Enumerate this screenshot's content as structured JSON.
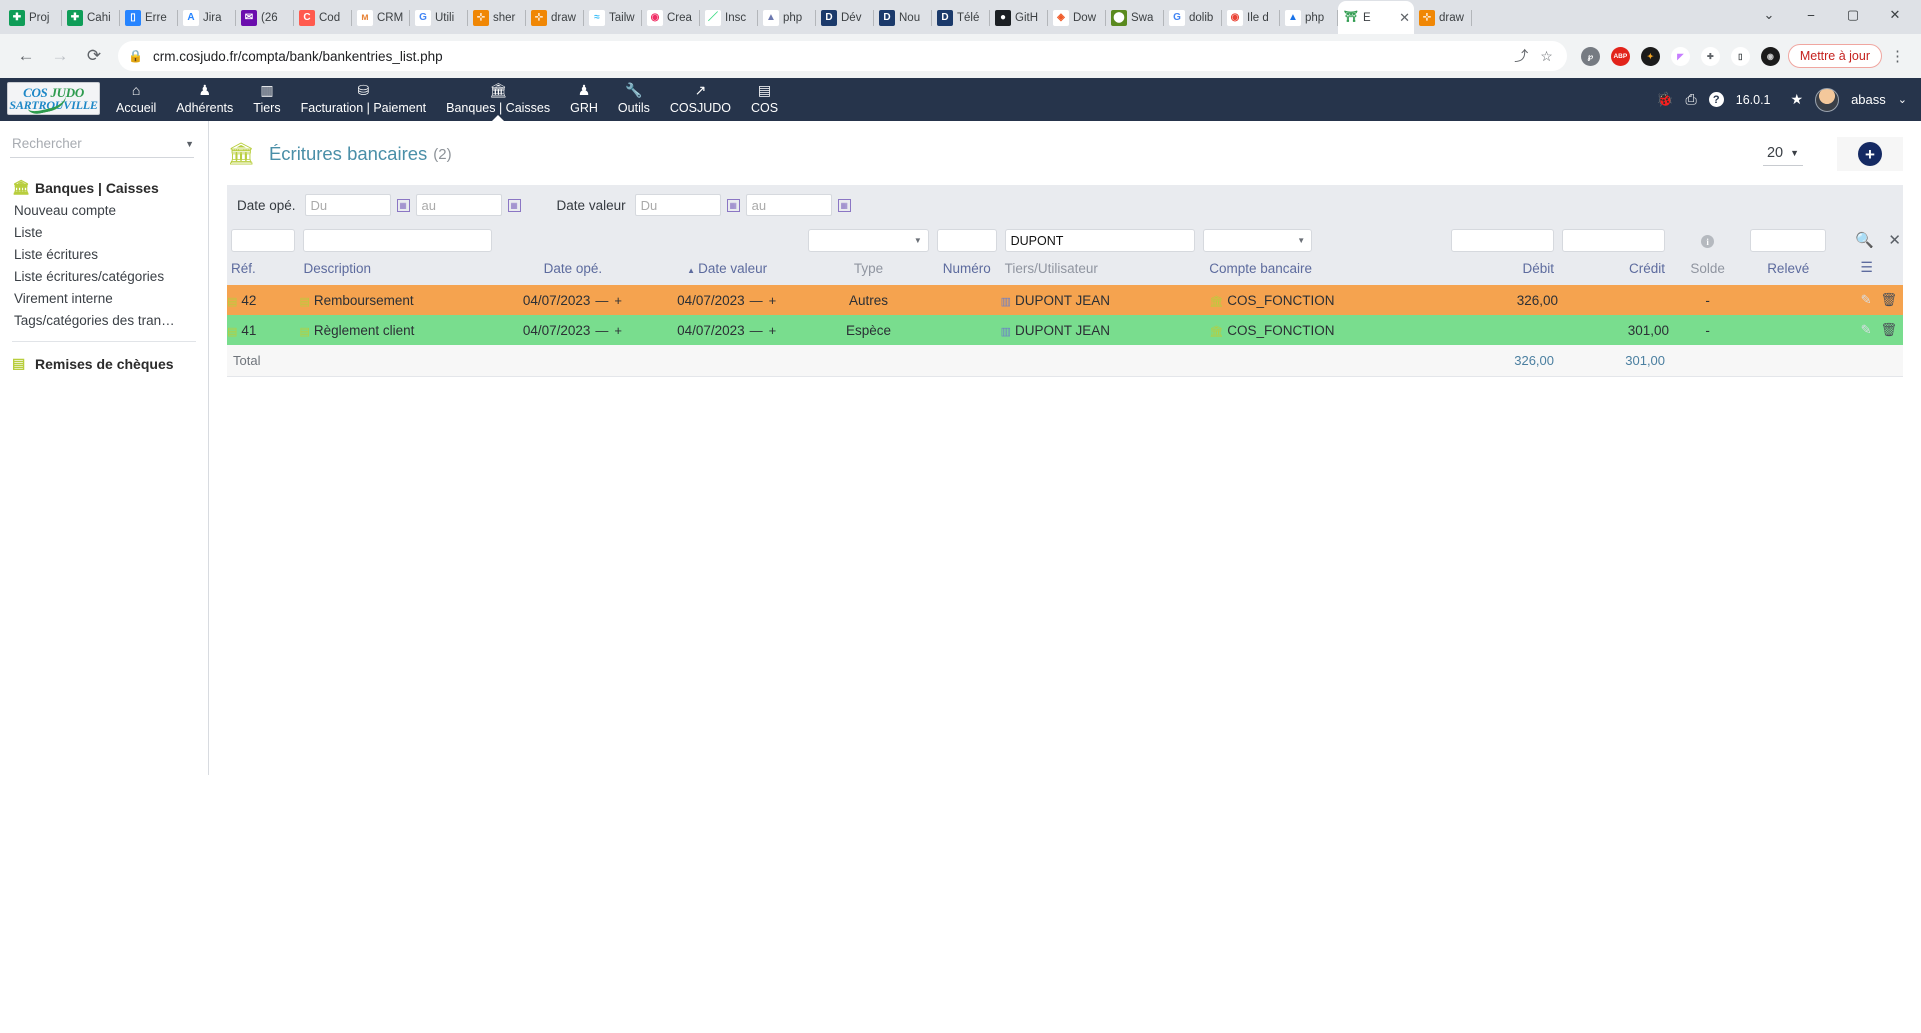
{
  "browser": {
    "tabs": [
      {
        "label": "Proj",
        "fav": "drive-green",
        "glyph": "✚",
        "bg": "#0f9d58"
      },
      {
        "label": "Cahi",
        "fav": "drive-green",
        "glyph": "✚",
        "bg": "#0f9d58"
      },
      {
        "label": "Erre",
        "fav": "trello",
        "glyph": "▯",
        "bg": "#2684ff"
      },
      {
        "label": "Jira",
        "fav": "jira",
        "glyph": "A",
        "bg": "#ffffff",
        "fg": "#2684ff"
      },
      {
        "label": "(26",
        "fav": "mail",
        "glyph": "✉",
        "bg": "#6a0dad"
      },
      {
        "label": "Cod",
        "fav": "clickup",
        "glyph": "C",
        "bg": "#ff5a4e"
      },
      {
        "label": "CRM",
        "fav": "crm",
        "glyph": "м",
        "bg": "#ffffff",
        "fg": "#e8853a"
      },
      {
        "label": "Utili",
        "fav": "google",
        "glyph": "G",
        "bg": "#ffffff",
        "fg": "#4285f4"
      },
      {
        "label": "sher",
        "fav": "drawio",
        "glyph": "⊹",
        "bg": "#f08705"
      },
      {
        "label": "draw",
        "fav": "drawio",
        "glyph": "⊹",
        "bg": "#f08705"
      },
      {
        "label": "Tailw",
        "fav": "tailwind",
        "glyph": "≈",
        "bg": "#ffffff",
        "fg": "#38bdf8"
      },
      {
        "label": "Crea",
        "fav": "appwrite",
        "glyph": "◉",
        "bg": "#ffffff",
        "fg": "#f02e65"
      },
      {
        "label": "Insc",
        "fav": "slash",
        "glyph": "／",
        "bg": "#ffffff",
        "fg": "#3ddc84"
      },
      {
        "label": "php",
        "fav": "phpmyadmin",
        "glyph": "▲",
        "bg": "#ffffff",
        "fg": "#6c78af"
      },
      {
        "label": "Dév",
        "fav": "dolibarr",
        "glyph": "D",
        "bg": "#1b3a6b"
      },
      {
        "label": "Nou",
        "fav": "dolibarr",
        "glyph": "D",
        "bg": "#1b3a6b"
      },
      {
        "label": "Télé",
        "fav": "dolibarr",
        "glyph": "D",
        "bg": "#1b3a6b"
      },
      {
        "label": "GitH",
        "fav": "github",
        "glyph": "●",
        "bg": "#1b1f23"
      },
      {
        "label": "Dow",
        "fav": "diamond",
        "glyph": "◈",
        "bg": "#ffffff",
        "fg": "#f05a28"
      },
      {
        "label": "Swa",
        "fav": "swagger",
        "glyph": "⬤",
        "bg": "#5a8a1f"
      },
      {
        "label": "dolib",
        "fav": "google",
        "glyph": "G",
        "bg": "#ffffff",
        "fg": "#4285f4"
      },
      {
        "label": "Ile d",
        "fav": "maps-pin",
        "glyph": "◉",
        "bg": "#ffffff",
        "fg": "#ea4335"
      },
      {
        "label": "php",
        "fav": "google-drive",
        "glyph": "▲",
        "bg": "#ffffff",
        "fg": "#1a73e8"
      },
      {
        "label": "draw",
        "fav": "drawio",
        "glyph": "⊹",
        "bg": "#f08705"
      }
    ],
    "active_tab": {
      "label": "É",
      "fav": "cosjudo",
      "glyph": "⛩",
      "bg": "#ffffff",
      "fg": "#2e9b4e",
      "close": "✕"
    },
    "window_controls": {
      "minimize": "⎯",
      "maximize": "▢",
      "close": "✕",
      "more": "⌄"
    },
    "nav": {
      "back": "←",
      "forward": "→",
      "reload": "⟳"
    },
    "omnibox": {
      "lock_icon": "lock-icon",
      "url": "crm.cosjudo.fr/compta/bank/bankentries_list.php",
      "share_icon": "share-icon",
      "bookmark_icon": "star-icon"
    },
    "extensions": [
      {
        "name": "pinterest-extension",
        "glyph": "℘",
        "bg": "#767b82",
        "fg": "#ffffff"
      },
      {
        "name": "adblock-plus-extension",
        "glyph": "ABP",
        "bg": "#e2231a",
        "fg": "#ffffff"
      },
      {
        "name": "honey-extension",
        "glyph": "✦",
        "bg": "#1b1b1b",
        "fg": "#f5a623"
      },
      {
        "name": "colorzilla-extension",
        "glyph": "◤",
        "bg": "#ffffff",
        "fg": "#c77dff"
      },
      {
        "name": "puzzle-extensions-icon",
        "glyph": "✚",
        "bg": "#ffffff",
        "fg": "#5f6368"
      },
      {
        "name": "sidepanel-icon",
        "glyph": "▯",
        "bg": "#ffffff",
        "fg": "#3c4043"
      },
      {
        "name": "profile-icon",
        "glyph": "◉",
        "bg": "#1b1b1b",
        "fg": "#cccccc"
      }
    ],
    "update_label": "Mettre à jour",
    "menu_icon": "kebab-menu-icon"
  },
  "appnav": {
    "logo": {
      "line1_a": "COS",
      "line1_b": "JUDO",
      "line2": "SARTROUVILLE"
    },
    "items": [
      {
        "label": "Accueil",
        "icon": "home-icon",
        "glyph": "⌂",
        "active": false
      },
      {
        "label": "Adhérents",
        "icon": "user-icon",
        "glyph": "♟",
        "active": false
      },
      {
        "label": "Tiers",
        "icon": "building-icon",
        "glyph": "▥",
        "active": false
      },
      {
        "label": "Facturation | Paiement",
        "icon": "invoice-icon",
        "glyph": "⛁",
        "active": false
      },
      {
        "label": "Banques | Caisses",
        "icon": "bank-icon",
        "glyph": "🏛",
        "active": true
      },
      {
        "label": "GRH",
        "icon": "hr-user-icon",
        "glyph": "♟",
        "active": false
      },
      {
        "label": "Outils",
        "icon": "wrench-icon",
        "glyph": "🔧",
        "active": false
      },
      {
        "label": "COSJUDO",
        "icon": "external-link-icon",
        "glyph": "↗",
        "active": false
      },
      {
        "label": "COS",
        "icon": "page-icon",
        "glyph": "▤",
        "active": false
      }
    ],
    "right": {
      "bug_icon": "bug-icon",
      "bug_glyph": "🐞",
      "print_icon": "printer-icon",
      "print_glyph": "⎙",
      "help_icon": "help-circle-icon",
      "help_glyph": "?",
      "version": "16.0.1",
      "star_icon": "star-bookmark-icon",
      "star_glyph": "★",
      "avatar": "user-avatar",
      "username": "abass",
      "caret": "⌄"
    }
  },
  "sidebar": {
    "search_placeholder": "Rechercher",
    "search_value": "",
    "caret_icon": "chevron-down-icon",
    "group_title": "Banques | Caisses",
    "group_icon": "bank-icon",
    "items": [
      {
        "label": "Nouveau compte"
      },
      {
        "label": "Liste"
      },
      {
        "label": "Liste écritures"
      },
      {
        "label": "Liste écritures/catégories"
      },
      {
        "label": "Virement interne"
      },
      {
        "label": "Tags/catégories des tran…"
      }
    ],
    "group2_title": "Remises de chèques",
    "group2_icon": "cheque-icon"
  },
  "main": {
    "icon": "bank-icon",
    "title": "Écritures bancaires",
    "count": "(2)",
    "limit_value": "20",
    "limit_caret": "⌄",
    "add_button": "+"
  },
  "filters": {
    "date_ope_label": "Date opé.",
    "date_ope_from": "",
    "date_ope_from_ph": "Du",
    "date_ope_to": "",
    "date_ope_to_ph": "au",
    "date_valeur_label": "Date valeur",
    "date_valeur_from": "",
    "date_valeur_from_ph": "Du",
    "date_valeur_to": "",
    "date_valeur_to_ph": "au",
    "ref": "",
    "description": "",
    "type": "",
    "numero": "",
    "tiers": "DUPONT",
    "compte": "",
    "debit": "",
    "credit": "",
    "solde_info_icon": "info-icon",
    "releve": "",
    "search_icon": "search-icon",
    "clear_icon": "clear-icon"
  },
  "table": {
    "headers": {
      "ref": "Réf.",
      "description": "Description",
      "date_ope": "Date opé.",
      "date_valeur": "Date valeur",
      "sort_indicator": "▲",
      "type": "Type",
      "numero": "Numéro",
      "tiers": "Tiers/Utilisateur",
      "compte": "Compte bancaire",
      "debit": "Débit",
      "credit": "Crédit",
      "solde": "Solde",
      "releve": "Relevé",
      "actions_icon": "column-selector-icon"
    },
    "rows": [
      {
        "ref": "42",
        "description": "Remboursement",
        "date_ope": "04/07/2023",
        "date_valeur": "04/07/2023",
        "type": "Autres",
        "numero": "",
        "tiers": "DUPONT JEAN",
        "compte": "COS_FONCTION",
        "debit": "326,00",
        "credit": "",
        "solde": "-",
        "releve": "",
        "rowclass": "orange",
        "minus": "—",
        "plus": "+",
        "edit_icon": "pencil-icon",
        "delete_icon": "trash-icon"
      },
      {
        "ref": "41",
        "description": "Règlement client",
        "date_ope": "04/07/2023",
        "date_valeur": "04/07/2023",
        "type": "Espèce",
        "numero": "",
        "tiers": "DUPONT JEAN",
        "compte": "COS_FONCTION",
        "debit": "",
        "credit": "301,00",
        "solde": "-",
        "releve": "",
        "rowclass": "green",
        "minus": "—",
        "plus": "+",
        "edit_icon": "pencil-icon",
        "delete_icon": "trash-icon"
      }
    ],
    "total": {
      "label": "Total",
      "debit": "326,00",
      "credit": "301,00"
    }
  }
}
